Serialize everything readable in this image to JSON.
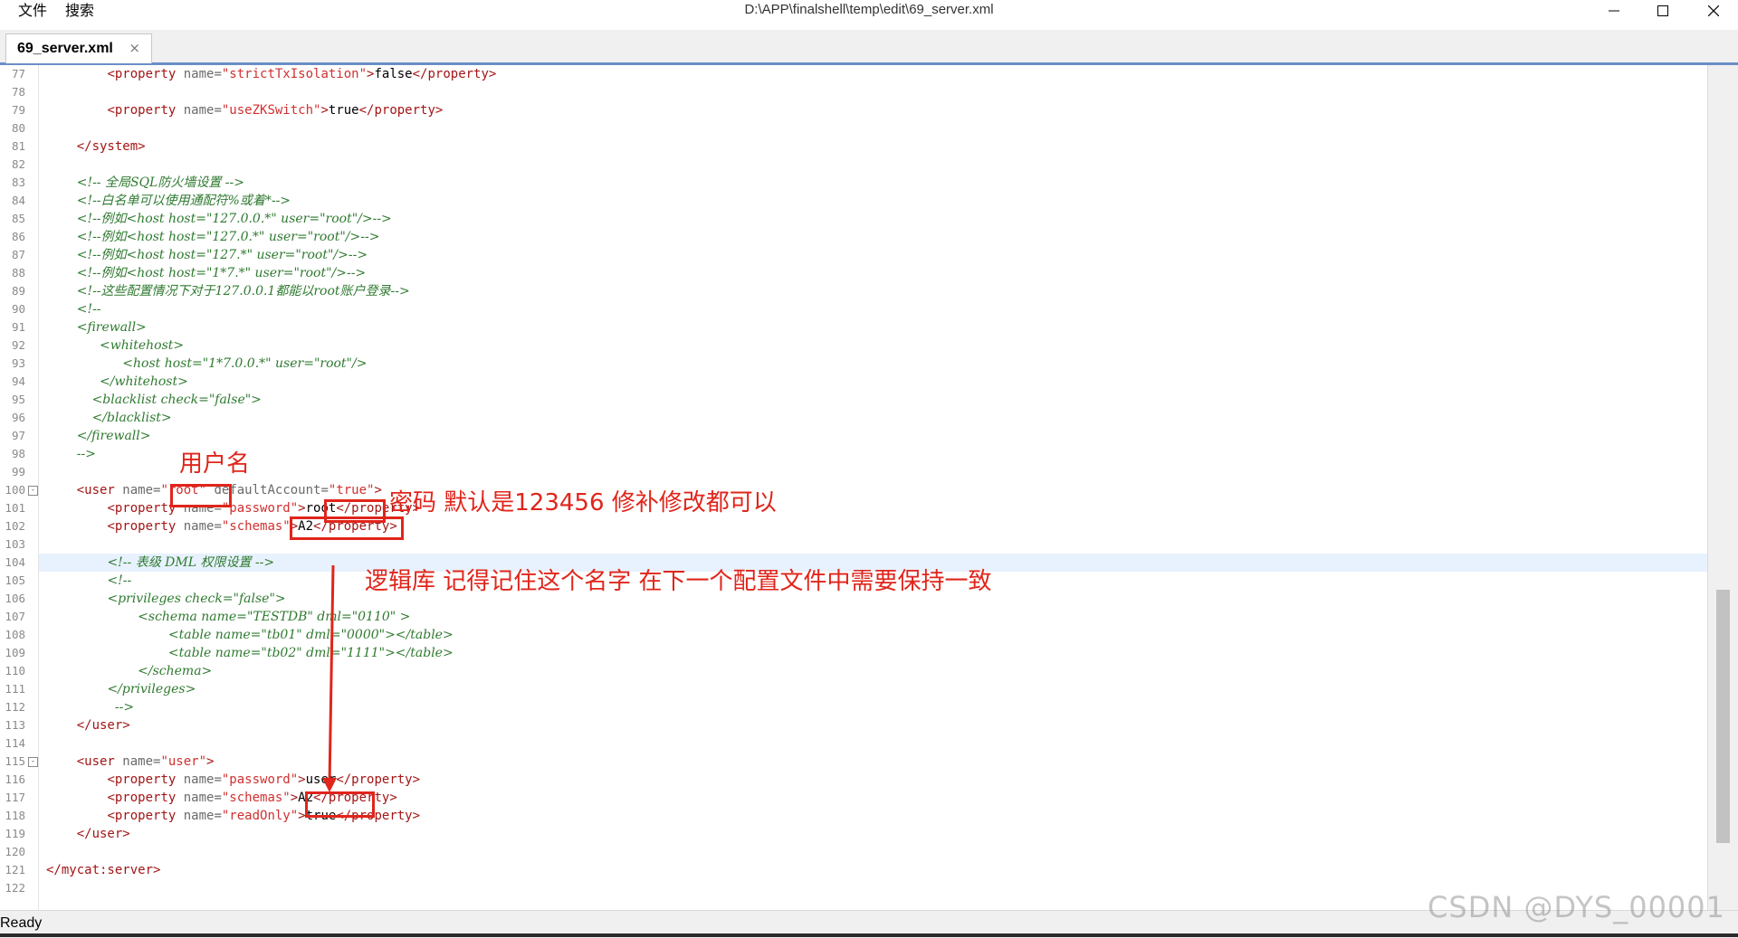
{
  "menu": {
    "file": "文件",
    "search": "搜索"
  },
  "window": {
    "title": "D:\\APP\\finalshell\\temp\\edit\\69_server.xml"
  },
  "tab": {
    "label": "69_server.xml",
    "close": "×"
  },
  "status": {
    "text": "Ready"
  },
  "watermark": "CSDN @DYS_00001",
  "annotations": {
    "username": "用户名",
    "password": "密码 默认是123456 修补修改都可以",
    "schema": "逻辑库 记得记住这个名字 在下一个配置文件中需要保持一致"
  },
  "colors": {
    "annotation": "#e0251b",
    "tag": "#a31515",
    "comment": "#2f7a30",
    "current_line": "#e8f2fe"
  },
  "lines": [
    {
      "n": "77",
      "tokens": [
        [
          "t",
          "        "
        ],
        [
          "g",
          "<property"
        ],
        [
          "a",
          " name="
        ],
        [
          "v",
          "\"strictTxIsolation\""
        ],
        [
          "g",
          ">"
        ],
        [
          "x",
          "false"
        ],
        [
          "g",
          "</property>"
        ]
      ]
    },
    {
      "n": "78",
      "tokens": []
    },
    {
      "n": "79",
      "tokens": [
        [
          "t",
          "        "
        ],
        [
          "g",
          "<property"
        ],
        [
          "a",
          " name="
        ],
        [
          "v",
          "\"useZKSwitch\""
        ],
        [
          "g",
          ">"
        ],
        [
          "x",
          "true"
        ],
        [
          "g",
          "</property>"
        ]
      ]
    },
    {
      "n": "80",
      "tokens": []
    },
    {
      "n": "81",
      "tokens": [
        [
          "t",
          "    "
        ],
        [
          "g",
          "</system>"
        ]
      ]
    },
    {
      "n": "82",
      "tokens": []
    },
    {
      "n": "83",
      "tokens": [
        [
          "t",
          "    "
        ],
        [
          "c",
          "<!-- 全局SQL防火墙设置 -->"
        ]
      ]
    },
    {
      "n": "84",
      "tokens": [
        [
          "t",
          "    "
        ],
        [
          "c",
          "<!--白名单可以使用通配符%或着*-->"
        ]
      ]
    },
    {
      "n": "85",
      "tokens": [
        [
          "t",
          "    "
        ],
        [
          "c",
          "<!--例如<host host=\"127.0.0.*\" user=\"root\"/>-->"
        ]
      ]
    },
    {
      "n": "86",
      "tokens": [
        [
          "t",
          "    "
        ],
        [
          "c",
          "<!--例如<host host=\"127.0.*\" user=\"root\"/>-->"
        ]
      ]
    },
    {
      "n": "87",
      "tokens": [
        [
          "t",
          "    "
        ],
        [
          "c",
          "<!--例如<host host=\"127.*\" user=\"root\"/>-->"
        ]
      ]
    },
    {
      "n": "88",
      "tokens": [
        [
          "t",
          "    "
        ],
        [
          "c",
          "<!--例如<host host=\"1*7.*\" user=\"root\"/>-->"
        ]
      ]
    },
    {
      "n": "89",
      "tokens": [
        [
          "t",
          "    "
        ],
        [
          "c",
          "<!--这些配置情况下对于127.0.0.1都能以root账户登录-->"
        ]
      ]
    },
    {
      "n": "90",
      "tokens": [
        [
          "t",
          "    "
        ],
        [
          "c",
          "<!--"
        ]
      ]
    },
    {
      "n": "91",
      "tokens": [
        [
          "t",
          "    "
        ],
        [
          "c",
          "<firewall>"
        ]
      ]
    },
    {
      "n": "92",
      "tokens": [
        [
          "t",
          "       "
        ],
        [
          "c",
          "<whitehost>"
        ]
      ]
    },
    {
      "n": "93",
      "tokens": [
        [
          "t",
          "          "
        ],
        [
          "c",
          "<host host=\"1*7.0.0.*\" user=\"root\"/>"
        ]
      ]
    },
    {
      "n": "94",
      "tokens": [
        [
          "t",
          "       "
        ],
        [
          "c",
          "</whitehost>"
        ]
      ]
    },
    {
      "n": "95",
      "tokens": [
        [
          "t",
          "      "
        ],
        [
          "c",
          "<blacklist check=\"false\">"
        ]
      ]
    },
    {
      "n": "96",
      "tokens": [
        [
          "t",
          "      "
        ],
        [
          "c",
          "</blacklist>"
        ]
      ]
    },
    {
      "n": "97",
      "tokens": [
        [
          "t",
          "    "
        ],
        [
          "c",
          "</firewall>"
        ]
      ]
    },
    {
      "n": "98",
      "tokens": [
        [
          "t",
          "    "
        ],
        [
          "c",
          "-->"
        ]
      ]
    },
    {
      "n": "99",
      "tokens": []
    },
    {
      "n": "100",
      "fold": "-",
      "tokens": [
        [
          "t",
          "    "
        ],
        [
          "g",
          "<user"
        ],
        [
          "a",
          " name="
        ],
        [
          "v",
          "\"root\""
        ],
        [
          "a",
          " defaultAccount="
        ],
        [
          "v",
          "\"true\""
        ],
        [
          "g",
          ">"
        ]
      ]
    },
    {
      "n": "101",
      "tokens": [
        [
          "t",
          "        "
        ],
        [
          "g",
          "<property"
        ],
        [
          "a",
          " name="
        ],
        [
          "v",
          "\"password\""
        ],
        [
          "g",
          ">"
        ],
        [
          "x",
          "root"
        ],
        [
          "g",
          "</property>"
        ]
      ]
    },
    {
      "n": "102",
      "tokens": [
        [
          "t",
          "        "
        ],
        [
          "g",
          "<property"
        ],
        [
          "a",
          " name="
        ],
        [
          "v",
          "\"schemas\""
        ],
        [
          "g",
          ">"
        ],
        [
          "x",
          "A2"
        ],
        [
          "g",
          "</property>"
        ]
      ]
    },
    {
      "n": "103",
      "tokens": []
    },
    {
      "n": "104",
      "hl": true,
      "tokens": [
        [
          "t",
          "        "
        ],
        [
          "c",
          "<!-- 表级 DML 权限设置 -->"
        ]
      ]
    },
    {
      "n": "105",
      "tokens": [
        [
          "t",
          "        "
        ],
        [
          "c",
          "<!--"
        ]
      ]
    },
    {
      "n": "106",
      "tokens": [
        [
          "t",
          "        "
        ],
        [
          "c",
          "<privileges check=\"false\">"
        ]
      ]
    },
    {
      "n": "107",
      "tokens": [
        [
          "t",
          "            "
        ],
        [
          "c",
          "<schema name=\"TESTDB\" dml=\"0110\" >"
        ]
      ]
    },
    {
      "n": "108",
      "tokens": [
        [
          "t",
          "                "
        ],
        [
          "c",
          "<table name=\"tb01\" dml=\"0000\"></table>"
        ]
      ]
    },
    {
      "n": "109",
      "tokens": [
        [
          "t",
          "                "
        ],
        [
          "c",
          "<table name=\"tb02\" dml=\"1111\"></table>"
        ]
      ]
    },
    {
      "n": "110",
      "tokens": [
        [
          "t",
          "            "
        ],
        [
          "c",
          "</schema>"
        ]
      ]
    },
    {
      "n": "111",
      "tokens": [
        [
          "t",
          "        "
        ],
        [
          "c",
          "</privileges>"
        ]
      ]
    },
    {
      "n": "112",
      "tokens": [
        [
          "t",
          "         "
        ],
        [
          "c",
          "-->"
        ]
      ]
    },
    {
      "n": "113",
      "tokens": [
        [
          "t",
          "    "
        ],
        [
          "g",
          "</user>"
        ]
      ]
    },
    {
      "n": "114",
      "tokens": []
    },
    {
      "n": "115",
      "fold": "-",
      "tokens": [
        [
          "t",
          "    "
        ],
        [
          "g",
          "<user"
        ],
        [
          "a",
          " name="
        ],
        [
          "v",
          "\"user\""
        ],
        [
          "g",
          ">"
        ]
      ]
    },
    {
      "n": "116",
      "tokens": [
        [
          "t",
          "        "
        ],
        [
          "g",
          "<property"
        ],
        [
          "a",
          " name="
        ],
        [
          "v",
          "\"password\""
        ],
        [
          "g",
          ">"
        ],
        [
          "x",
          "user"
        ],
        [
          "g",
          "</property>"
        ]
      ]
    },
    {
      "n": "117",
      "tokens": [
        [
          "t",
          "        "
        ],
        [
          "g",
          "<property"
        ],
        [
          "a",
          " name="
        ],
        [
          "v",
          "\"schemas\""
        ],
        [
          "g",
          ">"
        ],
        [
          "x",
          "A2"
        ],
        [
          "g",
          "</property>"
        ]
      ]
    },
    {
      "n": "118",
      "tokens": [
        [
          "t",
          "        "
        ],
        [
          "g",
          "<property"
        ],
        [
          "a",
          " name="
        ],
        [
          "v",
          "\"readOnly\""
        ],
        [
          "g",
          ">"
        ],
        [
          "x",
          "true"
        ],
        [
          "g",
          "</property>"
        ]
      ]
    },
    {
      "n": "119",
      "tokens": [
        [
          "t",
          "    "
        ],
        [
          "g",
          "</user>"
        ]
      ]
    },
    {
      "n": "120",
      "tokens": []
    },
    {
      "n": "121",
      "tokens": [
        [
          "g",
          "</mycat:server>"
        ]
      ]
    },
    {
      "n": "122",
      "tokens": []
    }
  ]
}
